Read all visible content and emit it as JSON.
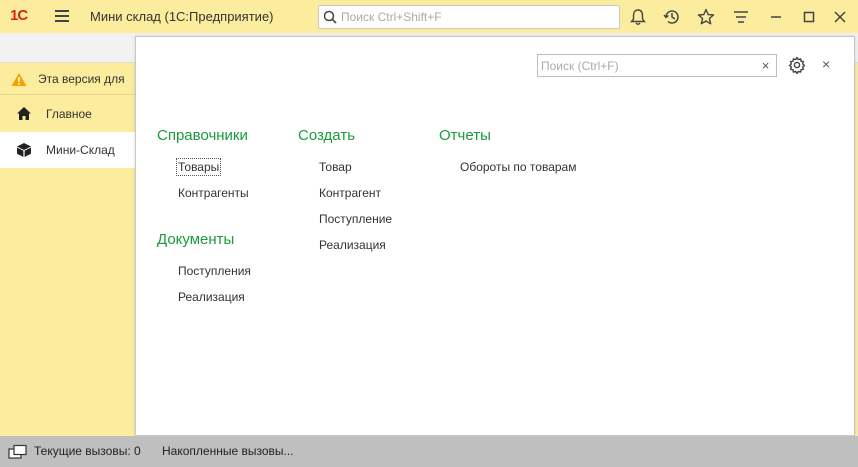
{
  "titlebar": {
    "logo": "1С",
    "app_title": "Мини склад  (1С:Предприятие)",
    "search_placeholder": "Поиск Ctrl+Shift+F"
  },
  "warning": {
    "text": "Эта версия для"
  },
  "sidebar": {
    "items": [
      {
        "label": "Главное",
        "icon": "home-icon"
      },
      {
        "label": "Мини-Склад",
        "icon": "box-icon"
      }
    ]
  },
  "panel": {
    "search_placeholder": "Поиск (Ctrl+F)",
    "clear_label": "×",
    "close_label": "×",
    "sections": {
      "catalogs": {
        "title": "Справочники",
        "links": [
          "Товары",
          "Контрагенты"
        ]
      },
      "documents": {
        "title": "Документы",
        "links": [
          "Поступления",
          "Реализация"
        ]
      },
      "create": {
        "title": "Создать",
        "links": [
          "Товар",
          "Контрагент",
          "Поступление",
          "Реализация"
        ]
      },
      "reports": {
        "title": "Отчеты",
        "links": [
          "Обороты по товарам"
        ]
      }
    }
  },
  "status": {
    "current_calls": "Текущие вызовы: 0",
    "accumulated_calls": "Накопленные вызовы..."
  },
  "colors": {
    "accent_yellow": "#fbec9e",
    "section_green": "#1a9b3c",
    "logo_red": "#d9261c"
  }
}
